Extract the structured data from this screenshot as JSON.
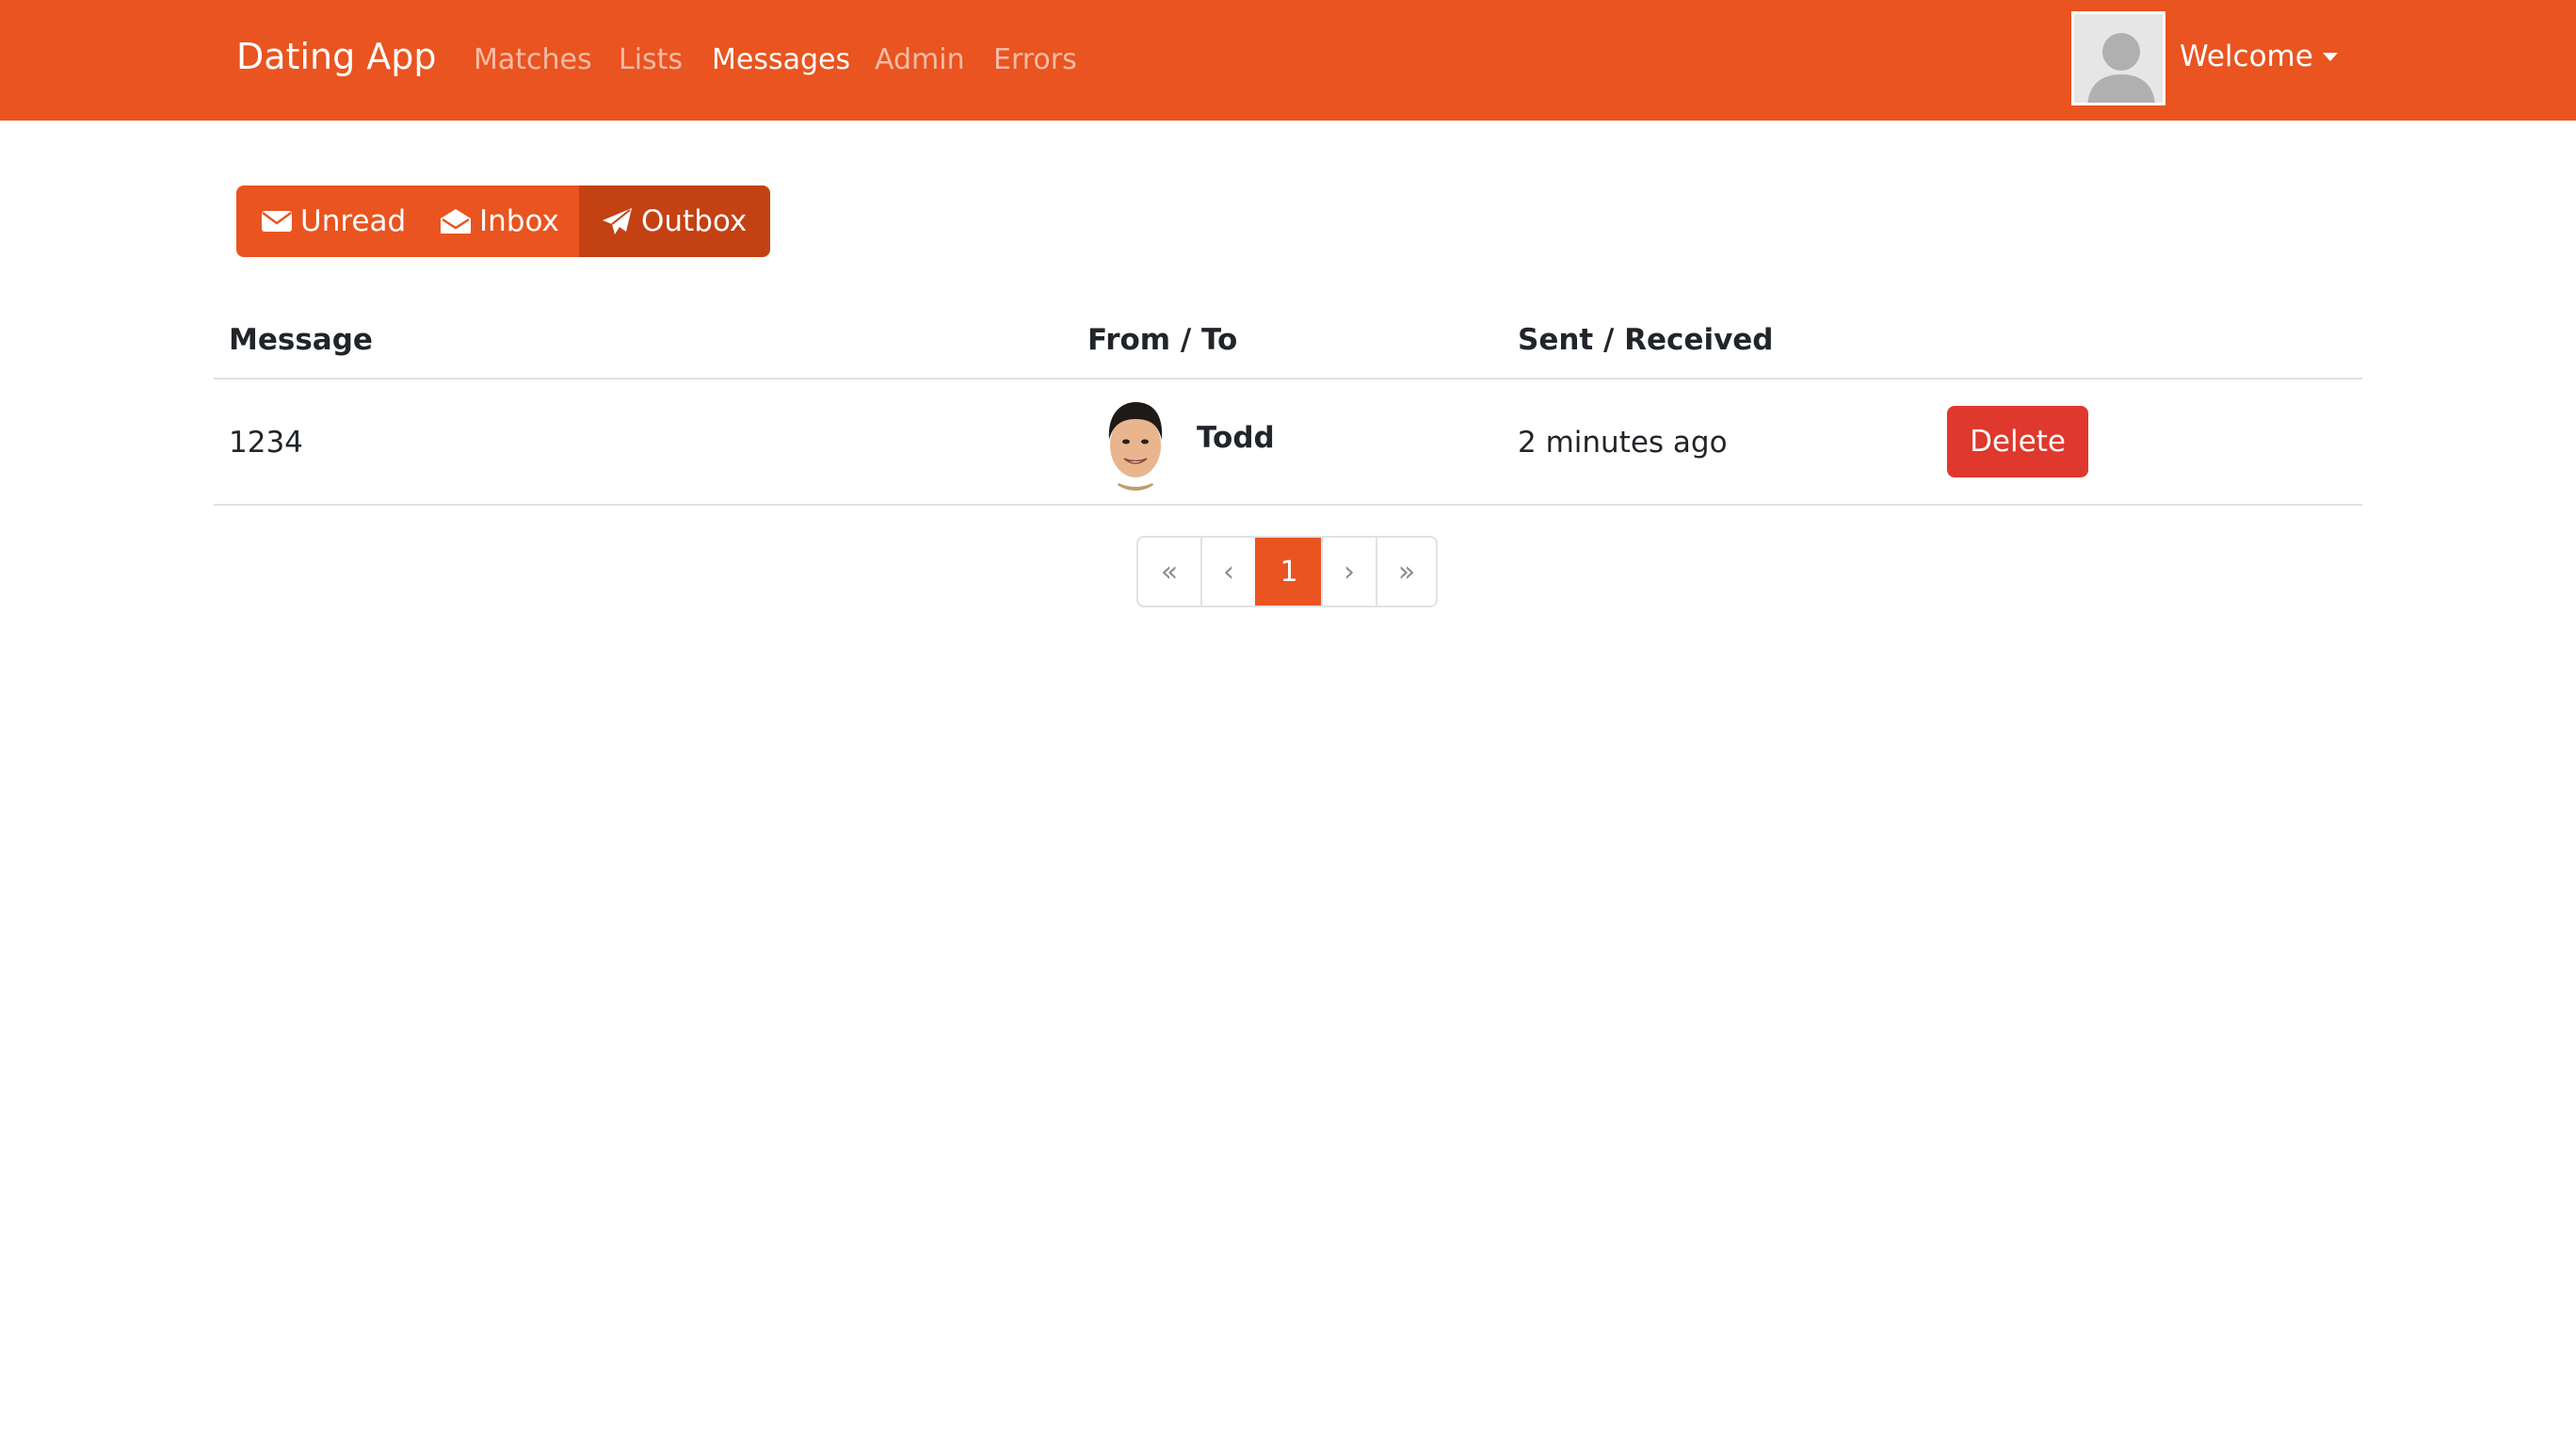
{
  "navbar": {
    "brand": "Dating App",
    "links": [
      "Matches",
      "Lists",
      "Messages",
      "Admin",
      "Errors"
    ],
    "active_link": "Messages",
    "user_menu_label": "Welcome",
    "color": "#e95420"
  },
  "message_tabs": {
    "unread_label": "Unread",
    "inbox_label": "Inbox",
    "outbox_label": "Outbox",
    "selected": "Outbox",
    "icons": [
      "envelope-icon",
      "envelope-open-icon",
      "paper-plane-icon"
    ]
  },
  "table": {
    "headers": [
      "Message",
      "From / To",
      "Sent / Received"
    ],
    "rows": [
      {
        "message": "1234",
        "user_name": "Todd",
        "time": "2 minutes ago",
        "action_label": "Delete"
      }
    ]
  },
  "pagination": {
    "first": "«",
    "prev": "‹",
    "current_page": "1",
    "next": "›",
    "last": "»"
  },
  "colors": {
    "primary": "#e95420",
    "primary_dark": "#c34113",
    "danger": "#df382c"
  }
}
